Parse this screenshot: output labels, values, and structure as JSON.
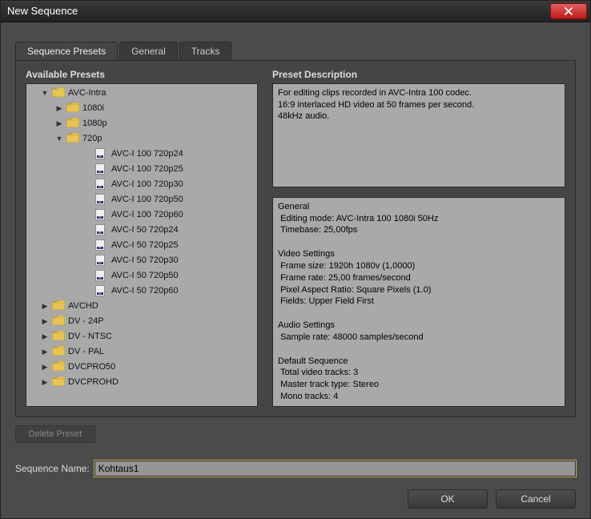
{
  "window": {
    "title": "New Sequence"
  },
  "tabs": [
    {
      "label": "Sequence Presets",
      "active": true
    },
    {
      "label": "General",
      "active": false
    },
    {
      "label": "Tracks",
      "active": false
    }
  ],
  "left": {
    "heading": "Available Presets",
    "tree": [
      {
        "label": "AVC-Intra",
        "type": "folder",
        "level": 1,
        "expanded": true
      },
      {
        "label": "1080i",
        "type": "folder",
        "level": 2,
        "expanded": false
      },
      {
        "label": "1080p",
        "type": "folder",
        "level": 2,
        "expanded": false
      },
      {
        "label": "720p",
        "type": "folder",
        "level": 2,
        "expanded": true
      },
      {
        "label": "AVC-I 100 720p24",
        "type": "preset",
        "level": 3
      },
      {
        "label": "AVC-I 100 720p25",
        "type": "preset",
        "level": 3
      },
      {
        "label": "AVC-I 100 720p30",
        "type": "preset",
        "level": 3
      },
      {
        "label": "AVC-I 100 720p50",
        "type": "preset",
        "level": 3
      },
      {
        "label": "AVC-I 100 720p60",
        "type": "preset",
        "level": 3
      },
      {
        "label": "AVC-I 50 720p24",
        "type": "preset",
        "level": 3
      },
      {
        "label": "AVC-I 50 720p25",
        "type": "preset",
        "level": 3
      },
      {
        "label": "AVC-I 50 720p30",
        "type": "preset",
        "level": 3
      },
      {
        "label": "AVC-I 50 720p50",
        "type": "preset",
        "level": 3
      },
      {
        "label": "AVC-I 50 720p60",
        "type": "preset",
        "level": 3
      },
      {
        "label": "AVCHD",
        "type": "folder",
        "level": 1,
        "expanded": false
      },
      {
        "label": "DV - 24P",
        "type": "folder",
        "level": 1,
        "expanded": false
      },
      {
        "label": "DV - NTSC",
        "type": "folder",
        "level": 1,
        "expanded": false
      },
      {
        "label": "DV - PAL",
        "type": "folder",
        "level": 1,
        "expanded": false
      },
      {
        "label": "DVCPRO50",
        "type": "folder",
        "level": 1,
        "expanded": false
      },
      {
        "label": "DVCPROHD",
        "type": "folder",
        "level": 1,
        "expanded": false
      }
    ]
  },
  "right": {
    "heading": "Preset Description",
    "description": "For editing clips recorded in AVC-Intra 100 codec.\n16:9 interlaced HD video at 50 frames per second.\n48kHz audio.",
    "details": "General\n Editing mode: AVC-Intra 100 1080i 50Hz\n Timebase: 25,00fps\n\nVideo Settings\n Frame size: 1920h 1080v (1,0000)\n Frame rate: 25,00 frames/second\n Pixel Aspect Ratio: Square Pixels (1.0)\n Fields: Upper Field First\n\nAudio Settings\n Sample rate: 48000 samples/second\n\nDefault Sequence\n Total video tracks: 3\n Master track type: Stereo\n Mono tracks: 4"
  },
  "buttons": {
    "delete": "Delete Preset",
    "ok": "OK",
    "cancel": "Cancel"
  },
  "sequence_name": {
    "label": "Sequence Name:",
    "value": "Kohtaus1"
  }
}
